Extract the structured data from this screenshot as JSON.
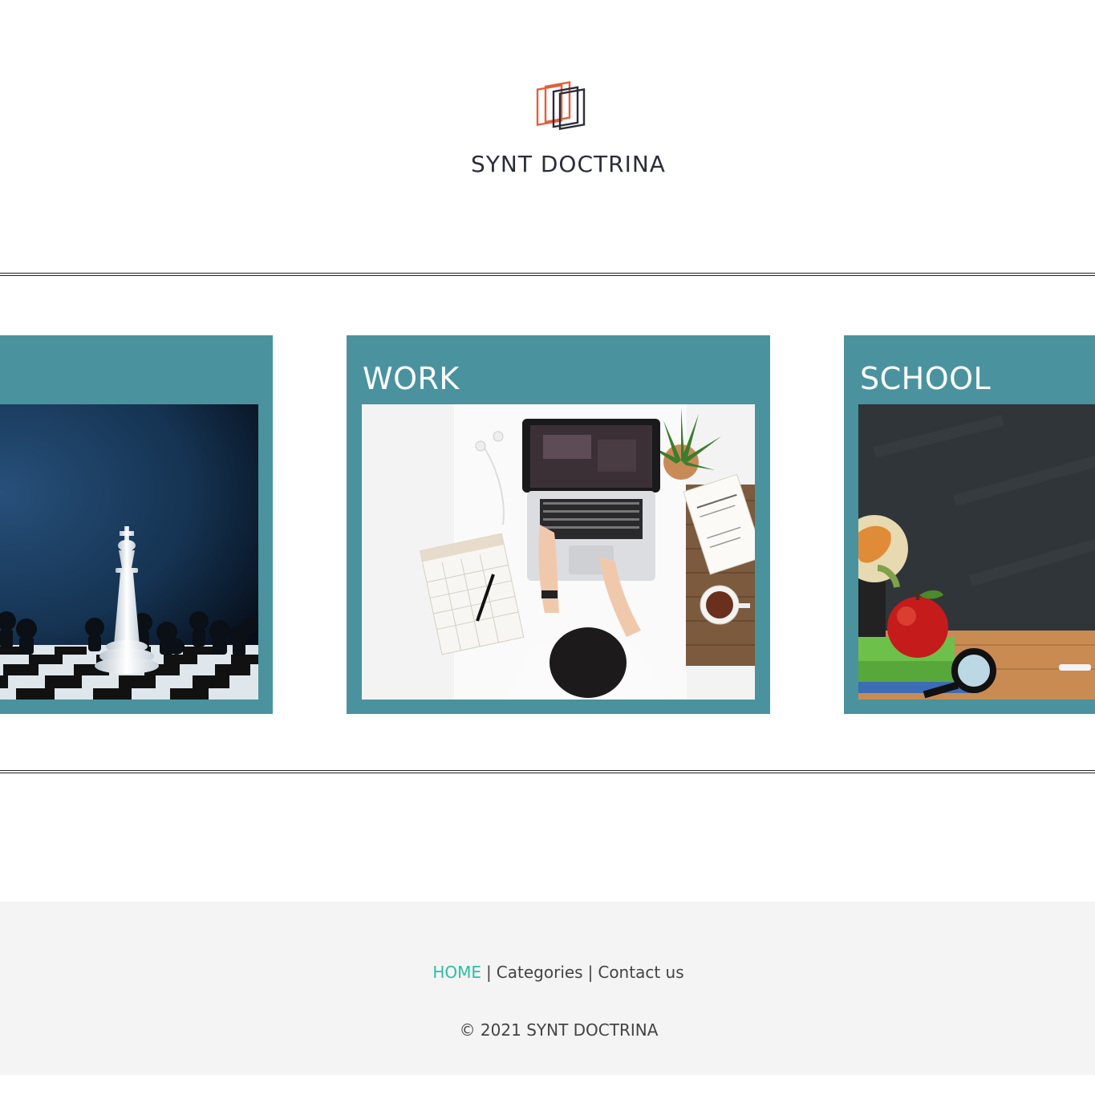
{
  "brand": {
    "name": "SYNT DOCTRINA",
    "logo_color_primary": "#e0603f",
    "logo_color_secondary": "#2b2d3a"
  },
  "categories": [
    {
      "title": "",
      "image": "chess-king-on-board"
    },
    {
      "title": "WORK",
      "image": "woman-working-on-laptop"
    },
    {
      "title": "SCHOOL",
      "image": "chalkboard-globe-apple"
    }
  ],
  "footer": {
    "nav": {
      "home": "HOME",
      "separator": "|",
      "categories": "Categories",
      "contact": "Contact us"
    },
    "copyright": "© 2021 SYNT DOCTRINA",
    "active_color": "#2bbfa4"
  },
  "theme": {
    "card_color": "#4a939e",
    "footer_bg": "#f4f4f4"
  }
}
